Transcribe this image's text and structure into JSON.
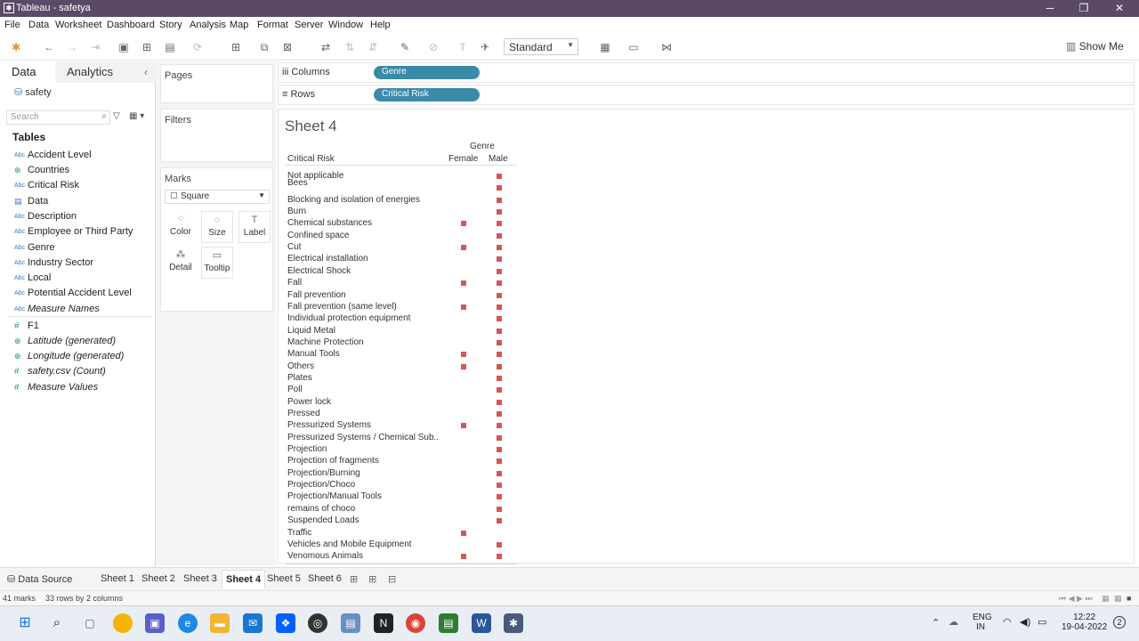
{
  "window": {
    "title": "Tableau - safetya",
    "minimize": "─",
    "maximize": "❐",
    "close": "✕"
  },
  "menu": [
    "File",
    "Data",
    "Worksheet",
    "Dashboard",
    "Story",
    "Analysis",
    "Map",
    "Format",
    "Server",
    "Window",
    "Help"
  ],
  "toolbar": {
    "fit_value": "Standard",
    "show_me": "Show Me"
  },
  "left_pane": {
    "tab_data": "Data",
    "tab_analytics": "Analytics",
    "datasource": "safety",
    "search_placeholder": "Search",
    "tables_heading": "Tables",
    "dimensions": [
      {
        "icon": "Abc",
        "label": "Accident Level"
      },
      {
        "icon": "⊕",
        "label": "Countries"
      },
      {
        "icon": "Abc",
        "label": "Critical Risk"
      },
      {
        "icon": "▤",
        "label": "Data"
      },
      {
        "icon": "Abc",
        "label": "Description"
      },
      {
        "icon": "Abc",
        "label": "Employee or Third Party"
      },
      {
        "icon": "Abc",
        "label": "Genre"
      },
      {
        "icon": "Abc",
        "label": "Industry Sector"
      },
      {
        "icon": "Abc",
        "label": "Local"
      },
      {
        "icon": "Abc",
        "label": "Potential Accident Level"
      },
      {
        "icon": "Abc",
        "label": "Measure Names"
      }
    ],
    "measures": [
      {
        "icon": "#",
        "label": "F1"
      },
      {
        "icon": "⊕",
        "label": "Latitude (generated)"
      },
      {
        "icon": "⊕",
        "label": "Longitude (generated)"
      },
      {
        "icon": "#",
        "label": "safety.csv (Count)"
      },
      {
        "icon": "#",
        "label": "Measure Values"
      }
    ]
  },
  "cards": {
    "pages": "Pages",
    "filters": "Filters",
    "marks": "Marks",
    "mark_type": "Square",
    "buttons": [
      "Color",
      "Size",
      "Label",
      "Detail",
      "Tooltip"
    ]
  },
  "shelves": {
    "columns_label": "Columns",
    "columns_pill": "Genre",
    "rows_label": "Rows",
    "rows_pill": "Critical Risk"
  },
  "view": {
    "sheet_title": "Sheet 4",
    "column_header": "Genre",
    "row_header": "Critical Risk"
  },
  "chart_data": {
    "type": "table",
    "columns": [
      "Female",
      "Male"
    ],
    "rows": [
      {
        "label": "Not applicable",
        "female": false,
        "male": true
      },
      {
        "label": "Bees",
        "female": false,
        "male": true
      },
      {
        "label": "Blocking and isolation of energies",
        "female": false,
        "male": true
      },
      {
        "label": "Burn",
        "female": false,
        "male": true
      },
      {
        "label": "Chemical substances",
        "female": true,
        "male": true
      },
      {
        "label": "Confined space",
        "female": false,
        "male": true
      },
      {
        "label": "Cut",
        "female": true,
        "male": true
      },
      {
        "label": "Electrical installation",
        "female": false,
        "male": true
      },
      {
        "label": "Electrical Shock",
        "female": false,
        "male": true
      },
      {
        "label": "Fall",
        "female": true,
        "male": true
      },
      {
        "label": "Fall prevention",
        "female": false,
        "male": true
      },
      {
        "label": "Fall prevention (same level)",
        "female": true,
        "male": true
      },
      {
        "label": "Individual protection equipment",
        "female": false,
        "male": true
      },
      {
        "label": "Liquid Metal",
        "female": false,
        "male": true
      },
      {
        "label": "Machine Protection",
        "female": false,
        "male": true
      },
      {
        "label": "Manual Tools",
        "female": true,
        "male": true
      },
      {
        "label": "Others",
        "female": true,
        "male": true
      },
      {
        "label": "Plates",
        "female": false,
        "male": true
      },
      {
        "label": "Poll",
        "female": false,
        "male": true
      },
      {
        "label": "Power lock",
        "female": false,
        "male": true
      },
      {
        "label": "Pressed",
        "female": false,
        "male": true
      },
      {
        "label": "Pressurized Systems",
        "female": true,
        "male": true
      },
      {
        "label": "Pressurized Systems / Chemical Sub..",
        "female": false,
        "male": true
      },
      {
        "label": "Projection",
        "female": false,
        "male": true
      },
      {
        "label": "Projection of fragments",
        "female": false,
        "male": true
      },
      {
        "label": "Projection/Burning",
        "female": false,
        "male": true
      },
      {
        "label": "Projection/Choco",
        "female": false,
        "male": true
      },
      {
        "label": "Projection/Manual Tools",
        "female": false,
        "male": true
      },
      {
        "label": "remains of choco",
        "female": false,
        "male": true
      },
      {
        "label": "Suspended Loads",
        "female": false,
        "male": true
      },
      {
        "label": "Traffic",
        "female": true,
        "male": false
      },
      {
        "label": "Vehicles and Mobile Equipment",
        "female": false,
        "male": true
      },
      {
        "label": "Venomous Animals",
        "female": true,
        "male": true
      }
    ],
    "mark_color": "#d65755"
  },
  "sheet_tabs": {
    "data_source": "Data Source",
    "sheets": [
      "Sheet 1",
      "Sheet 2",
      "Sheet 3",
      "Sheet 4",
      "Sheet 5",
      "Sheet 6"
    ],
    "active": "Sheet 4"
  },
  "status": {
    "marks": "41 marks",
    "dims": "33 rows by 2 columns"
  },
  "taskbar": {
    "lang": "ENG",
    "region": "IN",
    "time": "12:22",
    "date": "19-04-2022",
    "notifications": "2"
  }
}
